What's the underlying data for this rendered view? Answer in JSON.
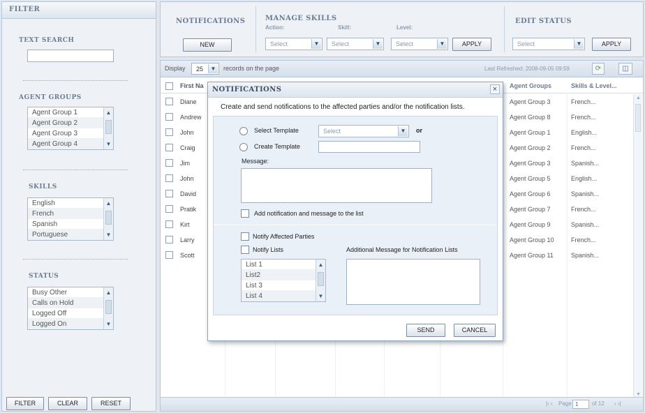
{
  "filter": {
    "title": "FILTER",
    "text_search_label": "TEXT SEARCH",
    "text_search_value": "",
    "agent_groups_label": "AGENT GROUPS",
    "agent_groups": [
      "Agent Group 1",
      "Agent Group 2",
      "Agent Group 3",
      "Agent Group 4"
    ],
    "skills_label": "SKILLS",
    "skills": [
      "English",
      "French",
      "Spanish",
      "Portuguese"
    ],
    "status_label": "STATUS",
    "status": [
      "Busy Other",
      "Calls on Hold",
      "Logged Off",
      "Logged On"
    ],
    "buttons": {
      "filter": "FILTER",
      "clear": "CLEAR",
      "reset": "RESET"
    }
  },
  "topbar": {
    "notifications_title": "NOTIFICATIONS",
    "new_button": "NEW",
    "manage_skills_title": "MANAGE SKILLS",
    "action_label": "Action:",
    "skill_label": "Skill:",
    "level_label": "Level:",
    "action_value": "Select",
    "skill_value": "Select",
    "level_value": "Select",
    "apply1": "APPLY",
    "edit_status_title": "EDIT STATUS",
    "status_value": "Select",
    "apply2": "APPLY"
  },
  "grid": {
    "display_label": "Display",
    "display_value": "25",
    "records_label": "records on the page",
    "last_refreshed": "Last Refreshed: 2008-09-05 09:59",
    "col_first_name": "First Na",
    "col_agent_groups": "Agent Groups",
    "col_skills": "Skills & Level...",
    "rows": [
      {
        "name": "Diane",
        "group": "Agent Group 3",
        "skill": "French..."
      },
      {
        "name": "Andrew",
        "group": "Agent Group 8",
        "skill": "French..."
      },
      {
        "name": "John",
        "group": "Agent Group 1",
        "skill": "English..."
      },
      {
        "name": "Craig",
        "group": "Agent Group 2",
        "skill": "French..."
      },
      {
        "name": "Jim",
        "group": "Agent Group 3",
        "skill": "Spanish..."
      },
      {
        "name": "John",
        "group": "Agent Group 5",
        "skill": "English..."
      },
      {
        "name": "David",
        "group": "Agent Group 6",
        "skill": "Spanish..."
      },
      {
        "name": "Pratik",
        "group": "Agent Group 7",
        "skill": "French..."
      },
      {
        "name": "Kirt",
        "group": "Agent Group 9",
        "skill": "Spanish..."
      },
      {
        "name": "Larry",
        "group": "Agent Group 10",
        "skill": "French..."
      },
      {
        "name": "Scott",
        "group": "Agent Group 11",
        "skill": "Spanish..."
      }
    ],
    "pager": {
      "page_label": "Page",
      "page_value": "1",
      "of_label": "of 12"
    }
  },
  "dialog": {
    "title": "NOTIFICATIONS",
    "close": "×",
    "intro": "Create and send notifications to the affected parties and/or the notification lists.",
    "select_template_label": "Select Template",
    "select_template_value": "Select",
    "or_label": "or",
    "create_template_label": "Create Template",
    "create_template_value": "",
    "message_label": "Message:",
    "message_value": "",
    "add_to_list_label": "Add notification and message to the list",
    "notify_affected_label": "Notify Affected Parties",
    "notify_lists_label": "Notify Lists",
    "additional_message_label": "Additional Message for Notification Lists",
    "lists": [
      "List 1",
      "List2",
      "List 3",
      "List 4"
    ],
    "send": "SEND",
    "cancel": "CANCEL"
  }
}
